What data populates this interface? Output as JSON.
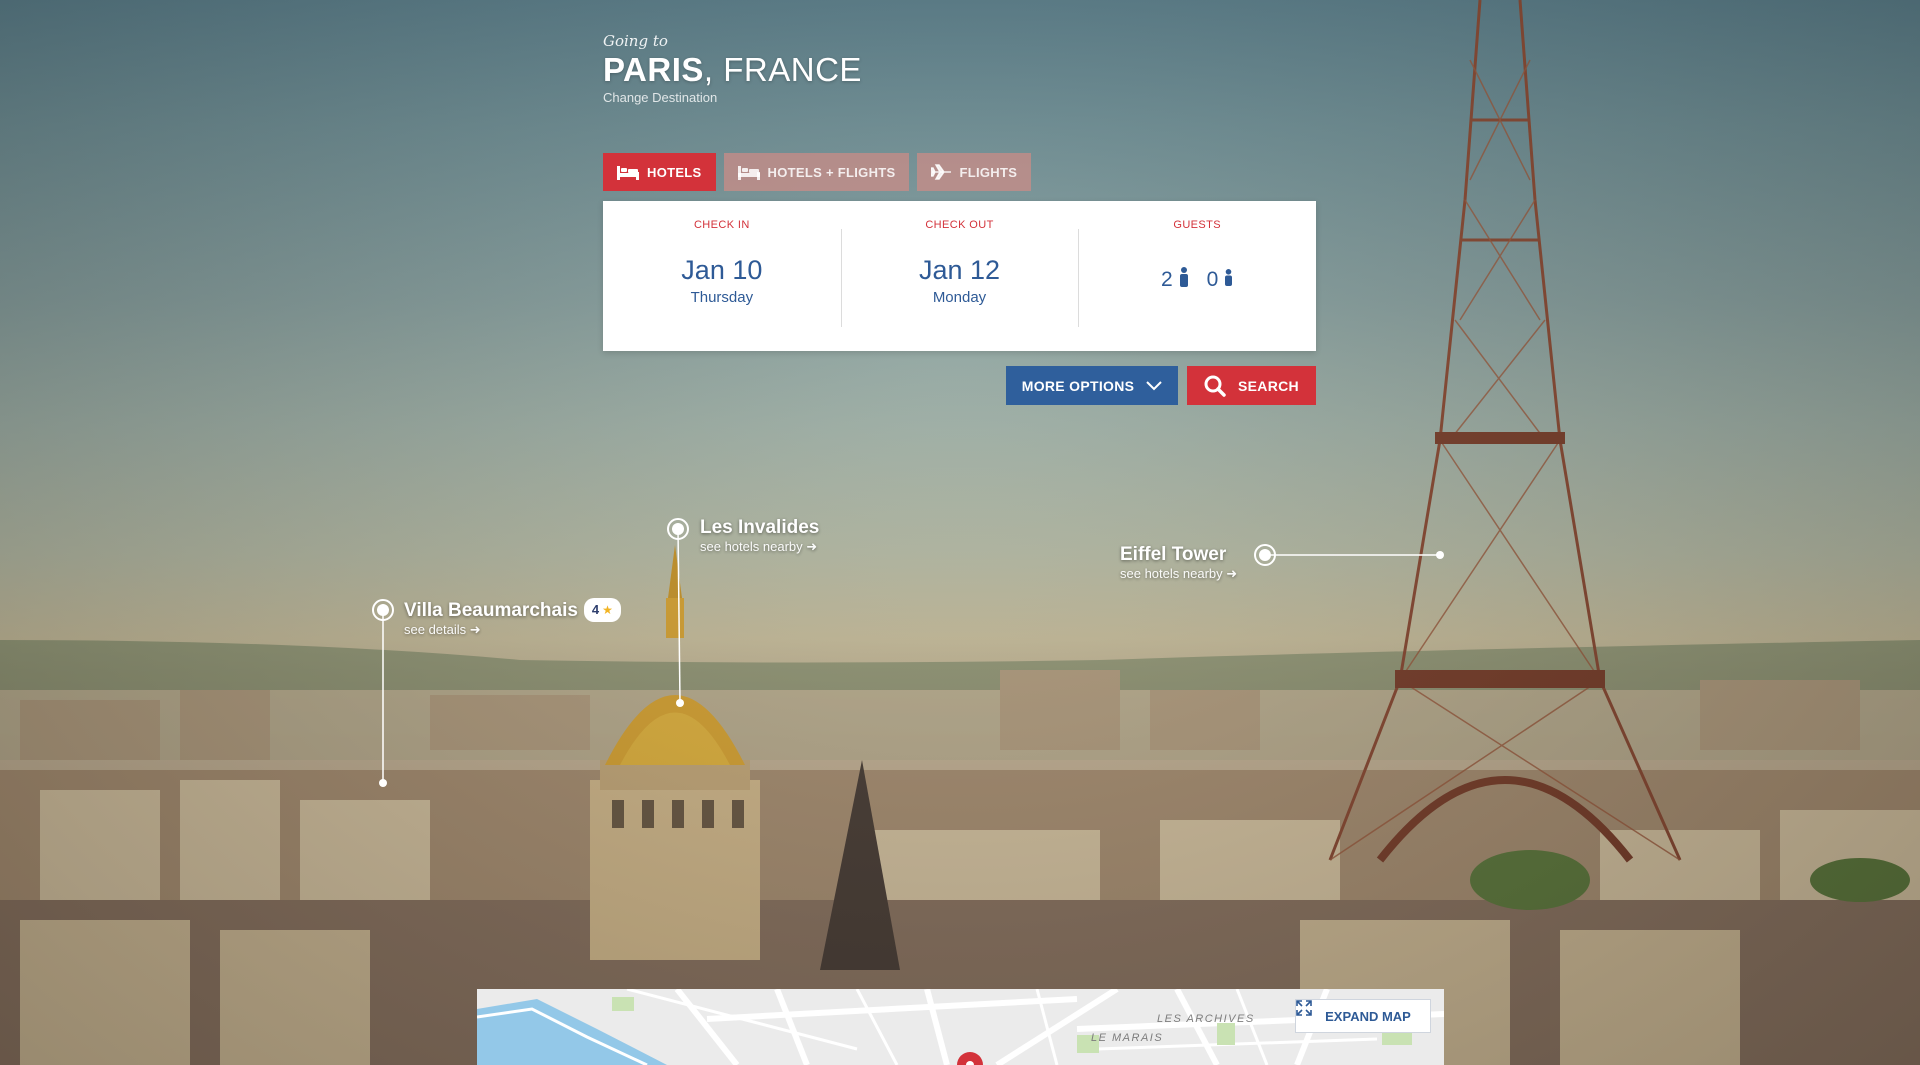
{
  "header": {
    "going_to": "Going to",
    "city": "PARIS",
    "country": ", FRANCE",
    "change_destination": "Change Destination"
  },
  "tabs": [
    {
      "label": "HOTELS",
      "icon": "bed-icon",
      "active": true
    },
    {
      "label": "HOTELS + FLIGHTS",
      "icon": "bed-icon",
      "active": false
    },
    {
      "label": "FLIGHTS",
      "icon": "plane-icon",
      "active": false
    }
  ],
  "search": {
    "check_in": {
      "label": "CHECK IN",
      "date": "Jan 10",
      "day": "Thursday"
    },
    "check_out": {
      "label": "CHECK OUT",
      "date": "Jan 12",
      "day": "Monday"
    },
    "guests": {
      "label": "GUESTS",
      "adults": "2",
      "children": "0"
    }
  },
  "actions": {
    "more_options": "MORE OPTIONS",
    "search": "SEARCH"
  },
  "landmarks": [
    {
      "name": "Les Invalides",
      "link": "see hotels nearby ➜"
    },
    {
      "name": "Eiffel Tower",
      "link": "see hotels nearby ➜"
    },
    {
      "name": "Villa Beaumarchais",
      "link": "see details ➜",
      "rating": "4"
    }
  ],
  "map": {
    "labels": [
      "LES ARCHIVES",
      "LE MARAIS"
    ],
    "expand": "EXPAND MAP"
  },
  "colors": {
    "accent_red": "#d3323a",
    "accent_blue": "#2f5f9c",
    "text_blue": "#2e5a96",
    "star": "#f2b423"
  }
}
